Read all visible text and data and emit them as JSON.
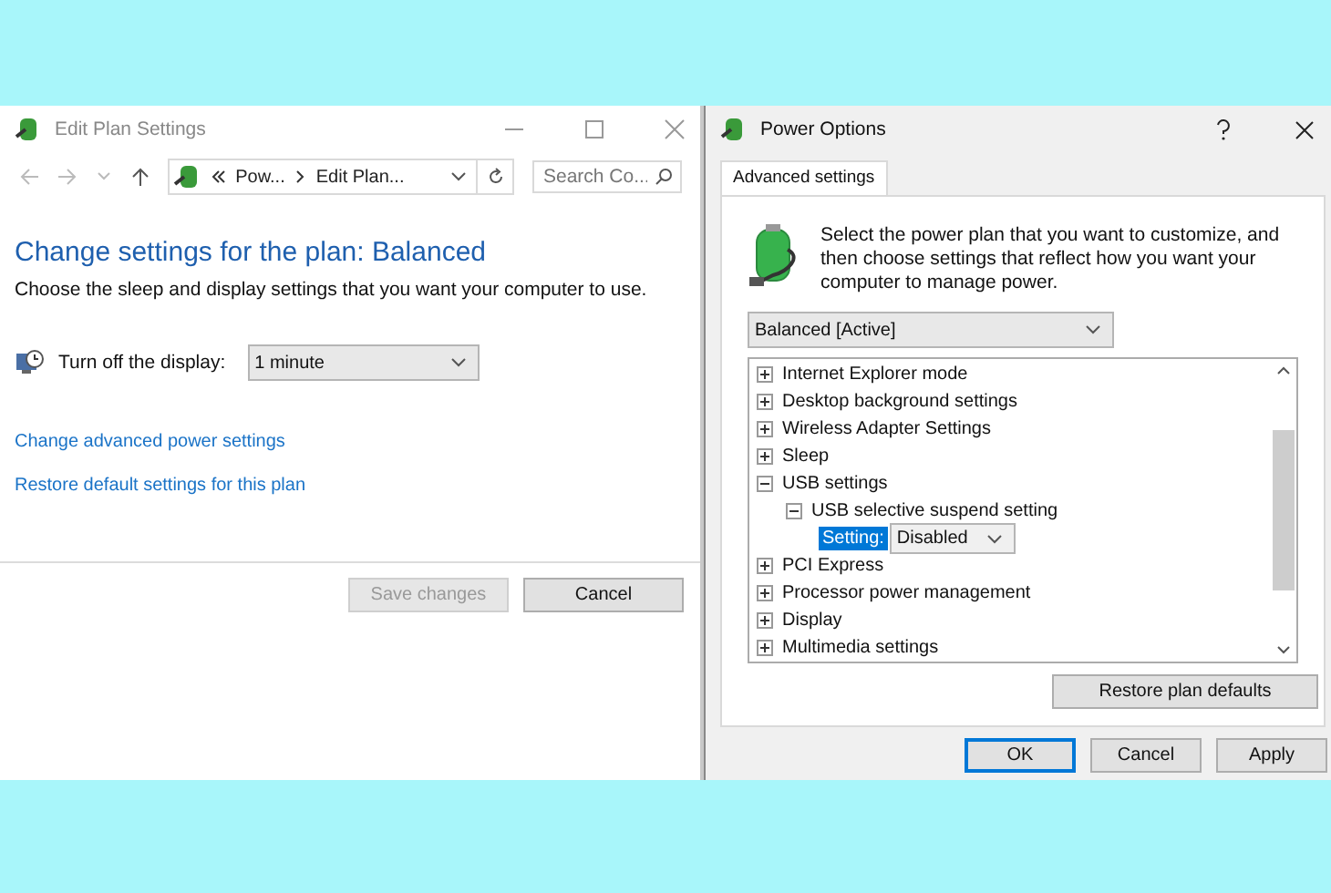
{
  "edit_window": {
    "title": "Edit Plan Settings",
    "address": {
      "crumbs": [
        "Pow...",
        "Edit Plan..."
      ]
    },
    "search": {
      "placeholder": "Search Co..."
    },
    "heading": "Change settings for the plan: Balanced",
    "description": "Choose the sleep and display settings that you want your computer to use.",
    "display_setting": {
      "label": "Turn off the display:",
      "value": "1 minute"
    },
    "links": [
      "Change advanced power settings",
      "Restore default settings for this plan"
    ],
    "buttons": [
      {
        "label": "Save changes",
        "disabled": true
      },
      {
        "label": "Cancel",
        "disabled": false
      }
    ]
  },
  "power_options": {
    "title": "Power Options",
    "tabs": [
      {
        "label": "Advanced settings",
        "selected": true
      }
    ],
    "intro": "Select the power plan that you want to customize, and then choose settings that reflect how you want your computer to manage power.",
    "plan": {
      "value": "Balanced [Active]"
    },
    "tree": [
      {
        "kind": "group",
        "label": "Internet Explorer mode",
        "expanded": false
      },
      {
        "kind": "group",
        "label": "Desktop background settings",
        "expanded": false
      },
      {
        "kind": "group",
        "label": "Wireless Adapter Settings",
        "expanded": false
      },
      {
        "kind": "group",
        "label": "Sleep",
        "expanded": false
      },
      {
        "kind": "group",
        "label": "USB settings",
        "expanded": true,
        "children": [
          {
            "kind": "group",
            "label": "USB selective suspend setting",
            "expanded": true,
            "children": [
              {
                "kind": "setting",
                "label": "Setting:",
                "value": "Disabled",
                "selected": true
              }
            ]
          }
        ]
      },
      {
        "kind": "group",
        "label": "PCI Express",
        "expanded": false
      },
      {
        "kind": "group",
        "label": "Processor power management",
        "expanded": false
      },
      {
        "kind": "group",
        "label": "Display",
        "expanded": false
      },
      {
        "kind": "group",
        "label": "Multimedia settings",
        "expanded": false
      }
    ],
    "restore_button": "Restore plan defaults",
    "buttons": [
      {
        "label": "OK",
        "default": true
      },
      {
        "label": "Cancel",
        "default": false
      },
      {
        "label": "Apply",
        "default": false
      }
    ]
  }
}
